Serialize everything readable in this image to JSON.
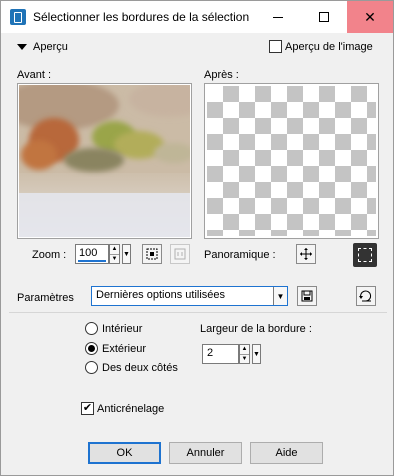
{
  "window": {
    "title": "Sélectionner les bordures de la sélection"
  },
  "preview": {
    "toggle_label": "Aperçu",
    "image_preview_label": "Aperçu de l'image",
    "image_preview_checked": false,
    "before_label": "Avant :",
    "after_label": "Après :"
  },
  "zoom": {
    "label": "Zoom :",
    "value": "100",
    "pan_label": "Panoramique :"
  },
  "settings": {
    "label": "Paramètres",
    "selected": "Dernières options utilisées"
  },
  "options": {
    "radios": [
      {
        "label": "Intérieur",
        "checked": false
      },
      {
        "label": "Extérieur",
        "checked": true
      },
      {
        "label": "Des deux côtés",
        "checked": false
      }
    ],
    "width_label": "Largeur de la bordure :",
    "width_value": "2",
    "antialias_label": "Anticrénelage",
    "antialias_checked": true
  },
  "buttons": {
    "ok": "OK",
    "cancel": "Annuler",
    "help": "Aide"
  },
  "colors": {
    "accent": "#1e73d0",
    "close_hover": "#f2838b"
  }
}
